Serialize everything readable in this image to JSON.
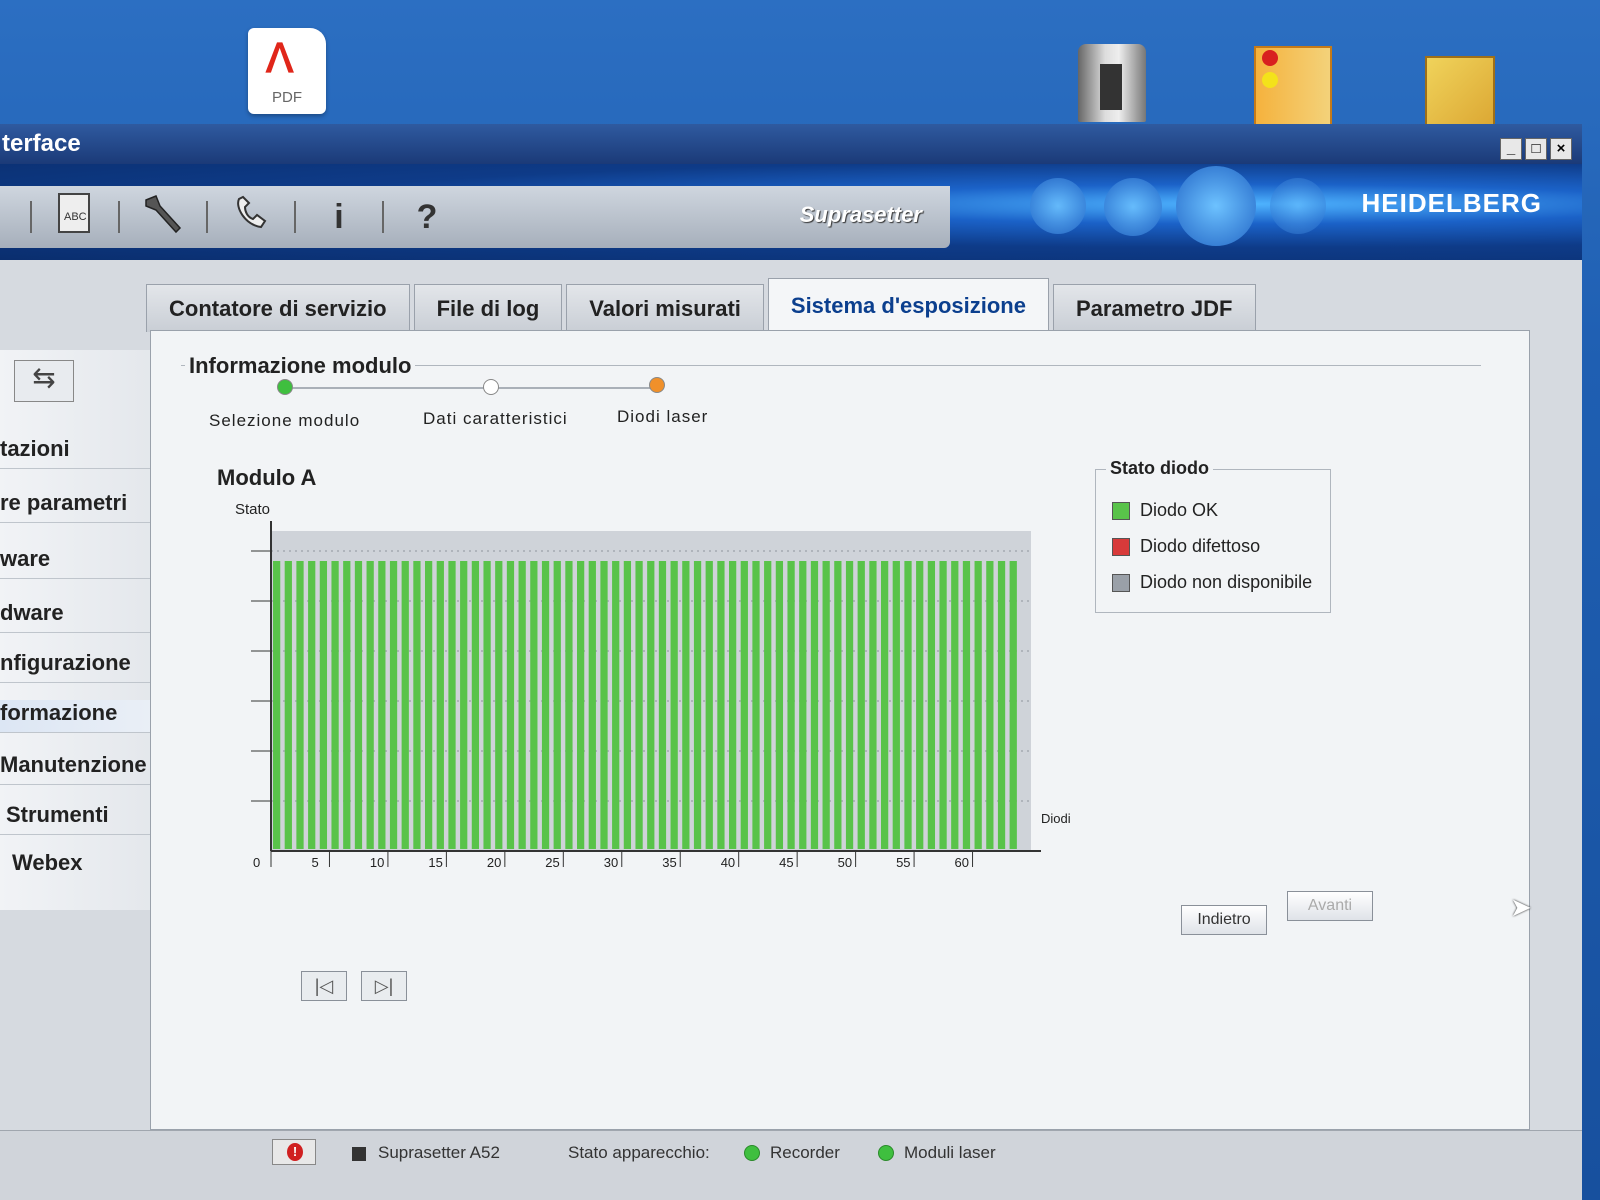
{
  "desktop": {
    "pdf_label": "PDF"
  },
  "window": {
    "title": "terface",
    "min": "_",
    "max": "□",
    "close": "×"
  },
  "toolbar": {
    "product": "Suprasetter",
    "logo": "HEIDELBERG",
    "icons": [
      "abc-doc-icon",
      "wrench-icon",
      "phone-icon",
      "info-icon",
      "help-icon"
    ],
    "info_glyph": "i",
    "help_glyph": "?"
  },
  "sidebar": {
    "items": [
      {
        "label": "tazioni"
      },
      {
        "label": "re parametri"
      },
      {
        "label": "ware"
      },
      {
        "label": "dware"
      },
      {
        "label": "nfigurazione"
      },
      {
        "label": "formazione"
      },
      {
        "label": "Manutenzione"
      },
      {
        "label": "Strumenti"
      },
      {
        "label": "Webex"
      }
    ],
    "selected": "formazione"
  },
  "tabs": [
    {
      "label": "Contatore di servizio"
    },
    {
      "label": "File di log"
    },
    {
      "label": "Valori misurati"
    },
    {
      "label": "Sistema d'esposizione"
    },
    {
      "label": "Parametro JDF"
    }
  ],
  "panel": {
    "group_title": "Informazione modulo",
    "steps": [
      {
        "label": "Selezione modulo",
        "color": "#3fbf3f"
      },
      {
        "label": "Dati caratteristici",
        "color": "#ffffff"
      },
      {
        "label": "Diodi laser",
        "color": "#f0902a"
      }
    ],
    "module_title": "Modulo A",
    "back_button": "Indietro",
    "next_button": "Avanti"
  },
  "legend": {
    "title": "Stato diodo",
    "items": [
      {
        "label": "Diodo OK",
        "color": "#59c34a"
      },
      {
        "label": "Diodo difettoso",
        "color": "#d83a3a"
      },
      {
        "label": "Diodo non disponibile",
        "color": "#9aa0a8"
      }
    ]
  },
  "chart_data": {
    "type": "bar",
    "ylabel": "Stato",
    "xlabel": "Diodi",
    "x_ticks": [
      0,
      5,
      10,
      15,
      20,
      25,
      30,
      35,
      40,
      45,
      50,
      55,
      60
    ],
    "diode_count": 64,
    "status": "OK",
    "xlim": [
      0,
      65
    ]
  },
  "statusbar": {
    "device": "Suprasetter A52",
    "state_label": "Stato apparecchio:",
    "recorder": "Recorder",
    "laser_modules": "Moduli laser"
  },
  "colors": {
    "accent": "#0b3f8e",
    "ok": "#59c34a",
    "chart_bg": "#cfd3d9"
  }
}
